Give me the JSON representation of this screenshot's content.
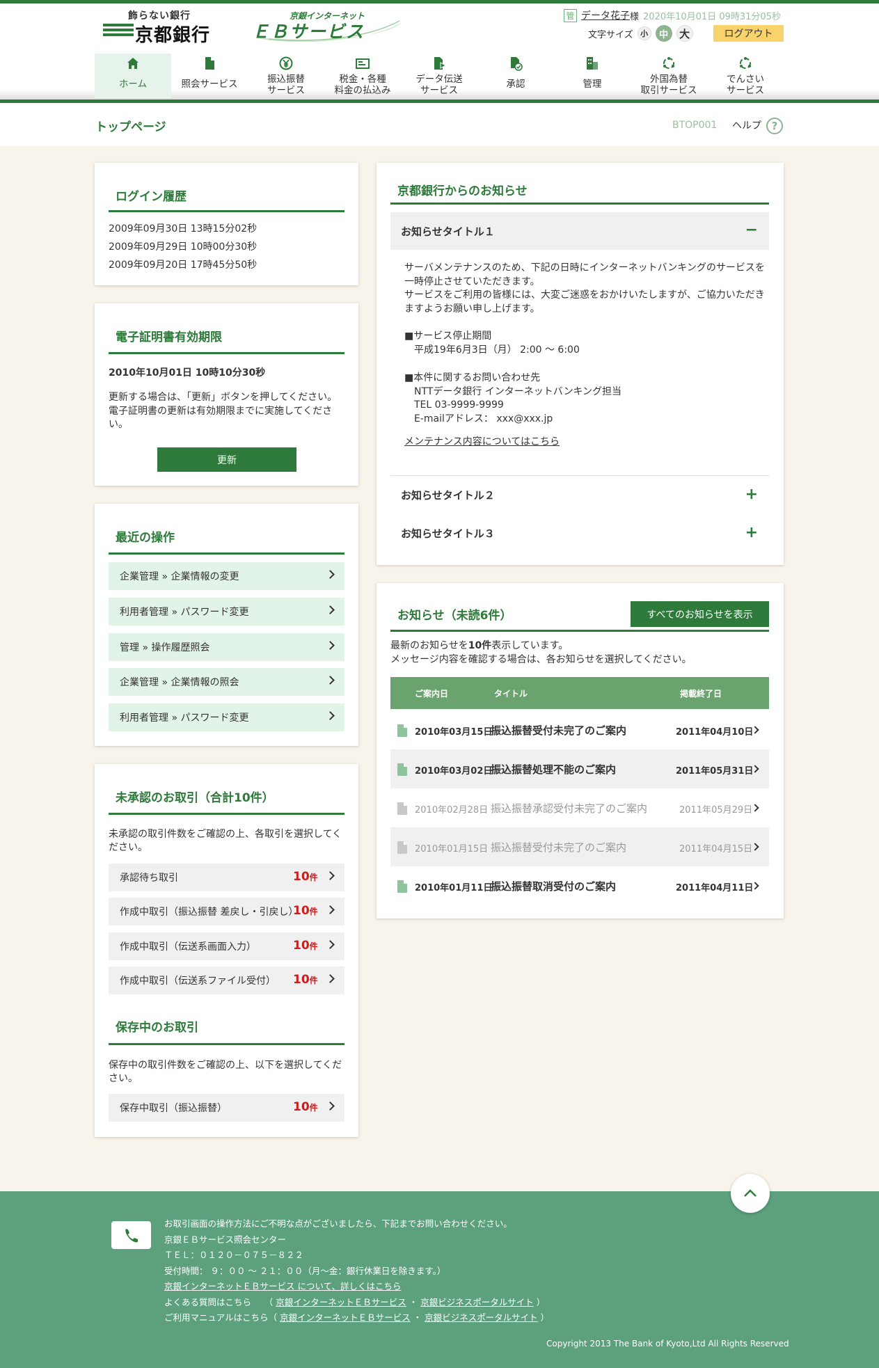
{
  "header": {
    "logo_tagline": "飾らない銀行",
    "logo_bank": "京都銀行",
    "eb_logo_sub": "京銀インターネット",
    "eb_logo_main": "ＥＢサービス",
    "user_badge": "管",
    "user_name": "データ花子",
    "user_suffix": "様",
    "login_time": "2020年10月01日 09時31分05秒",
    "font_size_label": "文字サイズ",
    "font_small": "小",
    "font_medium": "中",
    "font_large": "大",
    "logout_label": "ログアウト"
  },
  "nav": [
    {
      "line1": "ホーム",
      "line2": "",
      "icon": "home-icon"
    },
    {
      "line1": "照会サービス",
      "line2": "",
      "icon": "document-icon"
    },
    {
      "line1": "振込振替",
      "line2": "サービス",
      "icon": "yen-transfer-icon"
    },
    {
      "line1": "税金・各種",
      "line2": "料金の払込み",
      "icon": "payment-icon"
    },
    {
      "line1": "データ伝送",
      "line2": "サービス",
      "icon": "data-send-icon"
    },
    {
      "line1": "承認",
      "line2": "",
      "icon": "approve-icon"
    },
    {
      "line1": "管理",
      "line2": "",
      "icon": "manage-icon"
    },
    {
      "line1": "外国為替",
      "line2": "取引サービス",
      "icon": "fx-icon"
    },
    {
      "line1": "でんさい",
      "line2": "サービス",
      "icon": "densai-icon"
    }
  ],
  "page": {
    "title": "トップページ",
    "id": "BTOP001",
    "help_label": "ヘルプ",
    "help_icon": "?"
  },
  "login_history": {
    "title": "ログイン履歴",
    "items": [
      "2009年09月30日 13時15分02秒",
      "2009年09月29日 10時00分30秒",
      "2009年09月20日 17時45分50秒"
    ]
  },
  "certificate": {
    "title": "電子証明書有効期限",
    "expiry": "2010年10月01日 10時10分30秒",
    "note1": "更新する場合は、「更新」ボタンを押してください。",
    "note2": "電子証明書の更新は有効期限までに実施してください。",
    "button": "更新"
  },
  "recent": {
    "title": "最近の操作",
    "items": [
      "企業管理 » 企業情報の変更",
      "利用者管理 » パスワード変更",
      "管理 » 操作履歴照会",
      "企業管理 » 企業情報の照会",
      "利用者管理 » パスワード変更"
    ]
  },
  "pending": {
    "title": "未承認のお取引（合計10件）",
    "desc": "未承認の取引件数をご確認の上、各取引を選択してください。",
    "unit": "件",
    "items": [
      {
        "label": "承認待ち取引",
        "count": "10"
      },
      {
        "label": "作成中取引（振込振替 差戻し・引戻し）",
        "count": "10"
      },
      {
        "label": "作成中取引（伝送系画面入力）",
        "count": "10"
      },
      {
        "label": "作成中取引（伝送系ファイル受付）",
        "count": "10"
      }
    ]
  },
  "saved": {
    "title": "保存中のお取引",
    "desc": "保存中の取引件数をご確認の上、以下を選択してください。",
    "unit": "件",
    "items": [
      {
        "label": "保存中取引（振込振替）",
        "count": "10"
      }
    ]
  },
  "bank_notice": {
    "title": "京都銀行からのお知らせ",
    "items": [
      {
        "title": "お知らせタイトル１",
        "expanded": true
      },
      {
        "title": "お知らせタイトル２",
        "expanded": false
      },
      {
        "title": "お知らせタイトル３",
        "expanded": false
      }
    ],
    "body1": "サーバメンテナンスのため、下記の日時にインターネットバンキングのサービスを一時停止させていただきます。\nサービスをご利用の皆様には、大変ご迷惑をおかけいたしますが、ご協力いただきますようお願い申し上げます。",
    "body2": "■サービス停止期間\n　平成19年6月3日（月） 2:00 ～ 6:00",
    "body3": "■本件に関するお問い合わせ先\n　NTTデータ銀行 インターネットバンキング担当\n　TEL 03-9999-9999\n　E-mailアドレス： xxx@xxx.jp",
    "link": "メンテナンス内容についてはこちら"
  },
  "news": {
    "title": "お知らせ（未読6件）",
    "all_button": "すべてのお知らせを表示",
    "desc_pre": "最新のお知らせを",
    "desc_bold": "10件",
    "desc_post": "表示しています。",
    "desc2": "メッセージ内容を確認する場合は、各お知らせを選択してください。",
    "columns": {
      "date": "ご案内日",
      "title": "タイトル",
      "end": "掲載終了日"
    },
    "rows": [
      {
        "date": "2010年03月15日",
        "title": "振込振替受付未完了のご案内",
        "end": "2011年04月10日",
        "read": false
      },
      {
        "date": "2010年03月02日",
        "title": "振込振替処理不能のご案内",
        "end": "2011年05月31日",
        "read": false
      },
      {
        "date": "2010年02月28日",
        "title": "振込振替承認受付未完了のご案内",
        "end": "2011年05月29日",
        "read": true
      },
      {
        "date": "2010年01月15日",
        "title": "振込振替受付未完了のご案内",
        "end": "2011年04月15日",
        "read": true
      },
      {
        "date": "2010年01月11日",
        "title": "振込振替取消受付のご案内",
        "end": "2011年04月11日",
        "read": false
      }
    ]
  },
  "footer": {
    "line1": "お取引画面の操作方法にご不明な点がございましたら、下記までお問い合わせください。",
    "line2": "京銀ＥＢサービス照会センター",
    "line3": "ＴＥＬ：０１２０－０７５－８２２",
    "line4": "受付時間： ９：００ ～ ２１：００（月～金：銀行休業日を除きます。）",
    "line5": "京銀インターネットＥＢサービス について、詳しくはこちら",
    "faq_label": "よくある質問はこちら",
    "manual_label": "ご利用マニュアルはこちら",
    "link_eb": "京銀インターネットＥＢサービス",
    "link_portal": "京銀ビジネスポータルサイト",
    "open": "（",
    "dot": "・",
    "close": "）",
    "copyright": "Copyright 2013 The Bank of Kyoto,Ltd All Rights Reserved"
  },
  "colors": {
    "brand": "#2d7a3a",
    "footer": "#5ca07d",
    "alert": "#cc1d1d",
    "logout": "#f8d26a"
  }
}
